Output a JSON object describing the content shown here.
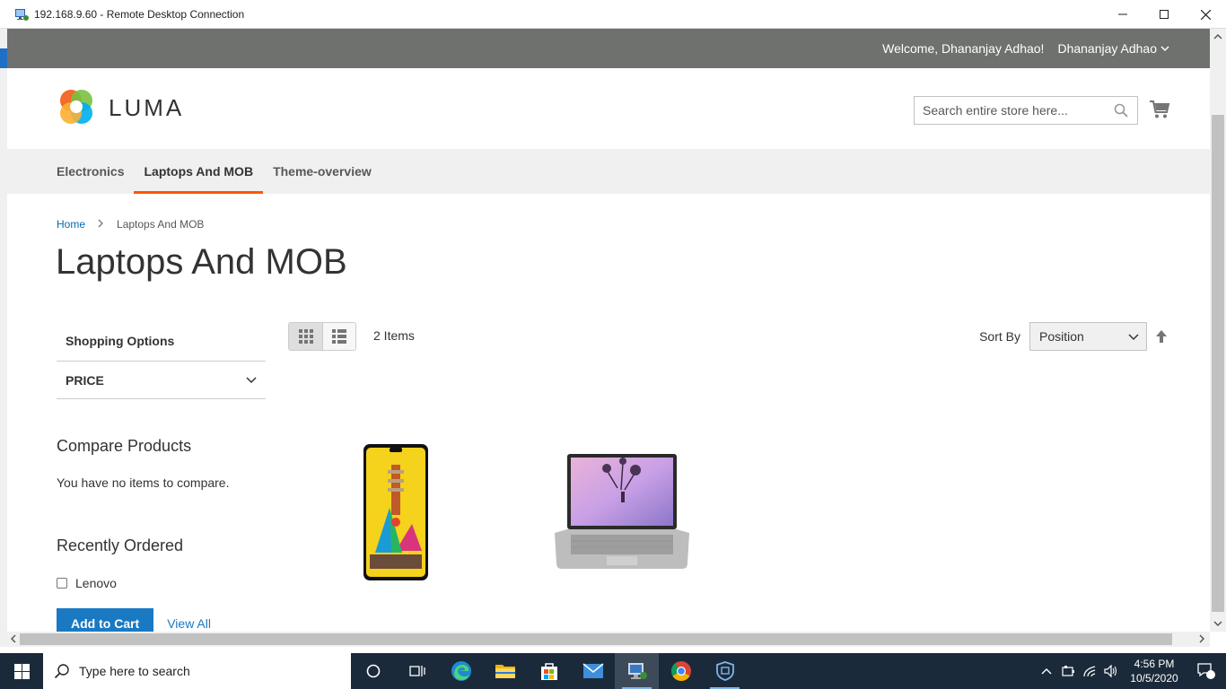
{
  "window": {
    "title": "192.168.9.60 - Remote Desktop Connection",
    "minimize_icon": "minimize-icon",
    "maximize_icon": "maximize-icon",
    "close_icon": "close-icon"
  },
  "header": {
    "welcome": "Welcome, Dhananjay Adhao!",
    "user_name": "Dhananjay Adhao",
    "logo_text": "LUMA",
    "search_placeholder": "Search entire store here..."
  },
  "nav": {
    "items": [
      {
        "label": "Electronics",
        "active": false
      },
      {
        "label": "Laptops And MOB",
        "active": true
      },
      {
        "label": "Theme-overview",
        "active": false
      }
    ]
  },
  "breadcrumbs": {
    "home": "Home",
    "current": "Laptops And MOB"
  },
  "page_title": "Laptops And MOB",
  "sidebar": {
    "shopping_options": "Shopping Options",
    "price_filter": "PRICE",
    "compare_title": "Compare Products",
    "compare_empty": "You have no items to compare.",
    "recent_title": "Recently Ordered",
    "recent_item": "Lenovo",
    "add_to_cart": "Add to Cart",
    "view_all": "View All"
  },
  "toolbar": {
    "amount": "2 Items",
    "sort_label": "Sort By",
    "sort_value": "Position"
  },
  "products": [
    {
      "type": "phone"
    },
    {
      "type": "laptop"
    }
  ],
  "taskbar": {
    "search_placeholder": "Type here to search",
    "time": "4:56 PM",
    "date": "10/5/2020",
    "notification_count": "1"
  },
  "colors": {
    "accent": "#ff5501",
    "link": "#006bb4",
    "primary_button": "#1979c3",
    "panel_header": "#6e716e",
    "taskbar": "#1b2a3a"
  }
}
